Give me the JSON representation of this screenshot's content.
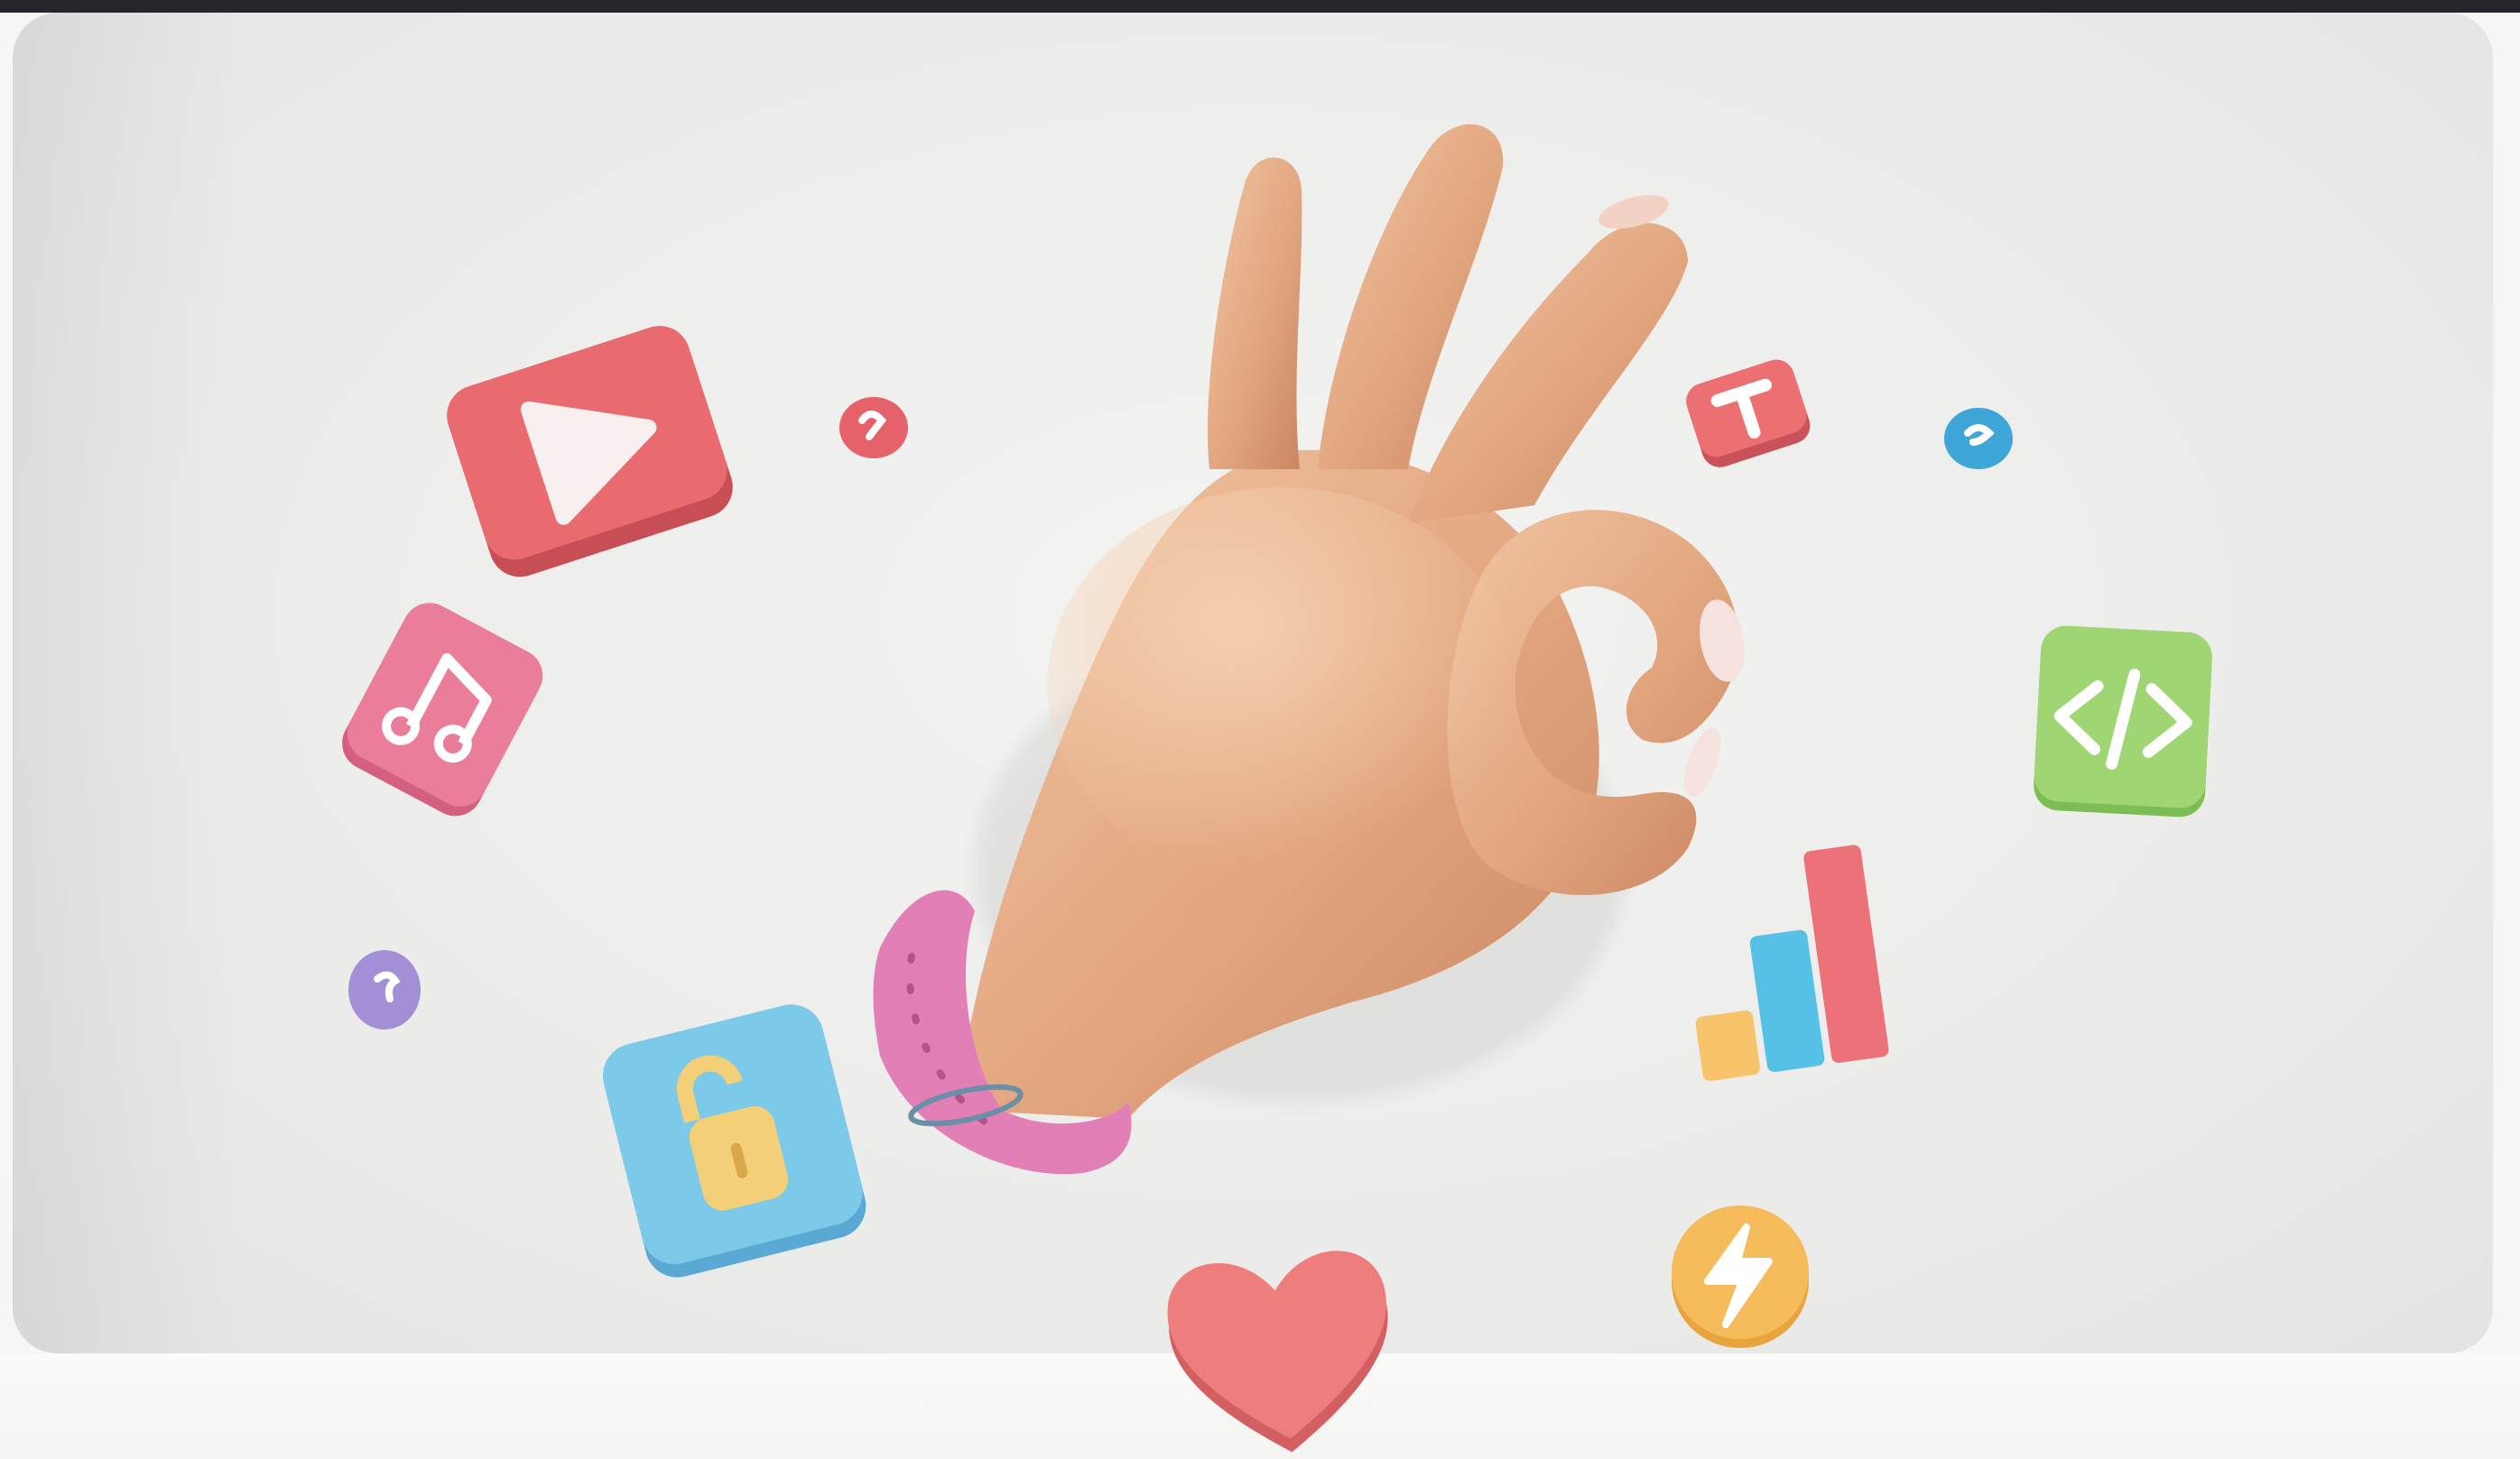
{
  "scene": {
    "background_color": "#ececea",
    "frame_color": "#23262b",
    "subject": "hand-ok-gesture",
    "icons": [
      {
        "name": "play-icon",
        "color": "#ea6b6f"
      },
      {
        "name": "music-note-icon",
        "color": "#ea7e9a"
      },
      {
        "name": "unlock-icon",
        "color": "#7dc9ea"
      },
      {
        "name": "heart-icon",
        "color": "#ee7e7e"
      },
      {
        "name": "lightning-icon",
        "color": "#f6bb5a"
      },
      {
        "name": "bar-chart-icon",
        "colors": [
          "#f7c46c",
          "#56c1e6",
          "#ec7179"
        ]
      },
      {
        "name": "code-icon",
        "color": "#9fd573"
      },
      {
        "name": "text-t-icon",
        "color": "#ec6f72"
      }
    ]
  }
}
